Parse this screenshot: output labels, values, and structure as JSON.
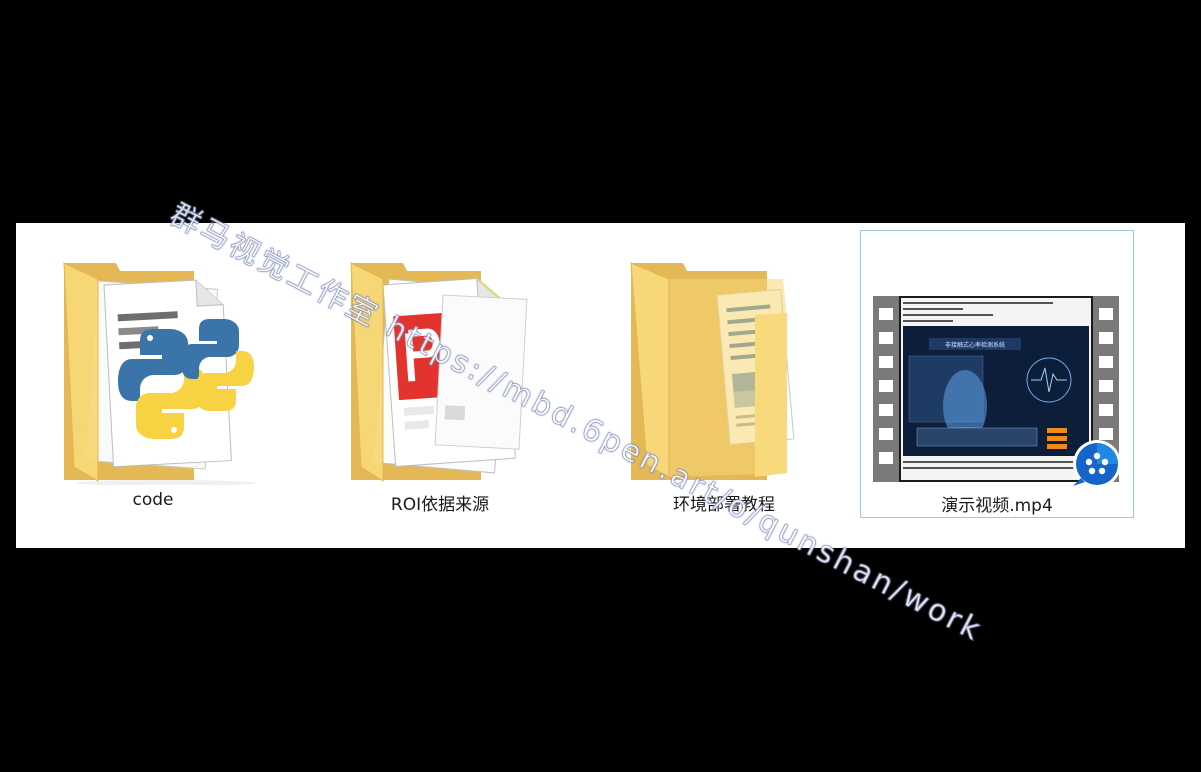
{
  "items": [
    {
      "name": "code",
      "icon": "folder-python-icon"
    },
    {
      "name": "ROI依据来源",
      "icon": "folder-pdf-icon"
    },
    {
      "name": "环境部署教程",
      "icon": "folder-document-icon"
    },
    {
      "name": "演示视频.mp4",
      "icon": "video-file-icon"
    }
  ],
  "video_thumb": {
    "title": "非接触式心率检测系统"
  },
  "watermark": "群马视觉工作室 https://mbd.6pen.art/o/qunshan/work",
  "colors": {
    "folder_back": "#e8be5c",
    "folder_front": "#f9dc82",
    "selection_border": "#99c9ef",
    "background": "#000000",
    "panel": "#ffffff"
  }
}
